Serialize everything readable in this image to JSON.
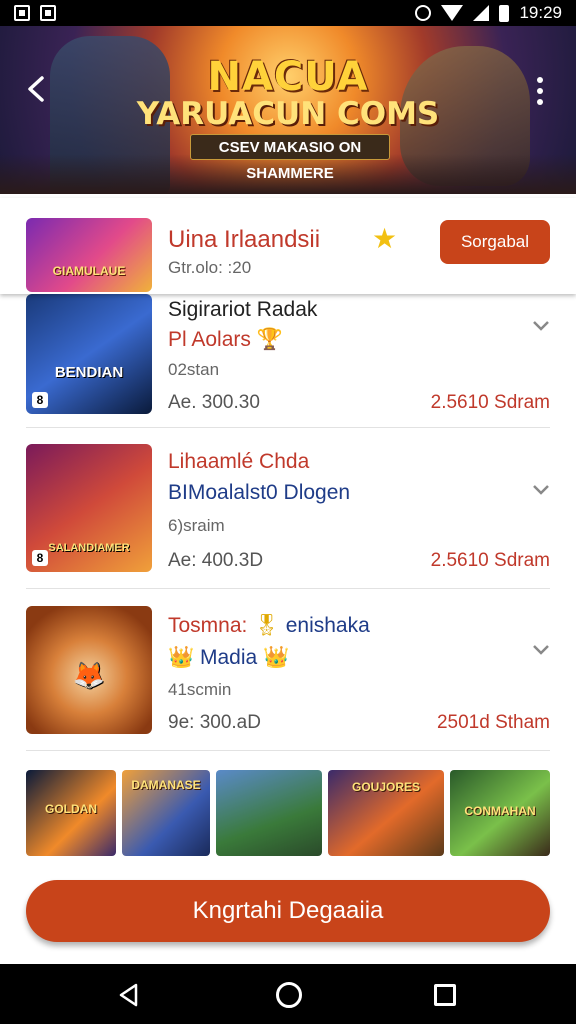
{
  "status_bar": {
    "time": "19:29"
  },
  "banner": {
    "title": "NACUA",
    "subtitle": "YARUACUN COMS",
    "tag": "CSEV MAKASIO ON SHAMMERE"
  },
  "pinned": {
    "thumb_label": "GIAMULAUE",
    "title": "Uina Irlaandsii",
    "meta": "Gtr.olo: :20",
    "button_label": "Sorgabal"
  },
  "games": [
    {
      "thumb_label": "BENDIAN",
      "title": "Sigirariot Radak",
      "subtitle": "Pl Aolars",
      "subtitle_emoji": "🏆",
      "meta": "02stan",
      "price": "Ae. 300.30",
      "stream": "2.5610 Sdram"
    },
    {
      "thumb_label": "SALANDIAMER",
      "title": "Lihaamlé Chda",
      "subtitle": "BIMoalalst0 Dlogen",
      "meta": "6)sraim",
      "price": "Ae: 400.3D",
      "stream": "2.5610 Sdram"
    },
    {
      "thumb_label": "",
      "title": "Tosmna: ",
      "title_tail": "enishaka",
      "subtitle": "Madia",
      "meta": "41scmin",
      "price": "9e: 300.aD",
      "stream": "2501d Stham"
    }
  ],
  "carousel": [
    {
      "label": "GOLDAN"
    },
    {
      "label": "DAMANASE"
    },
    {
      "label": ""
    },
    {
      "label": "GOUJORES"
    },
    {
      "label": "CONMAHAN"
    }
  ],
  "cta": {
    "label": "Kngrtahi Degaaiia"
  },
  "colors": {
    "accent": "#c8441a",
    "title_red": "#c0392b",
    "title_blue": "#1f3c88"
  }
}
